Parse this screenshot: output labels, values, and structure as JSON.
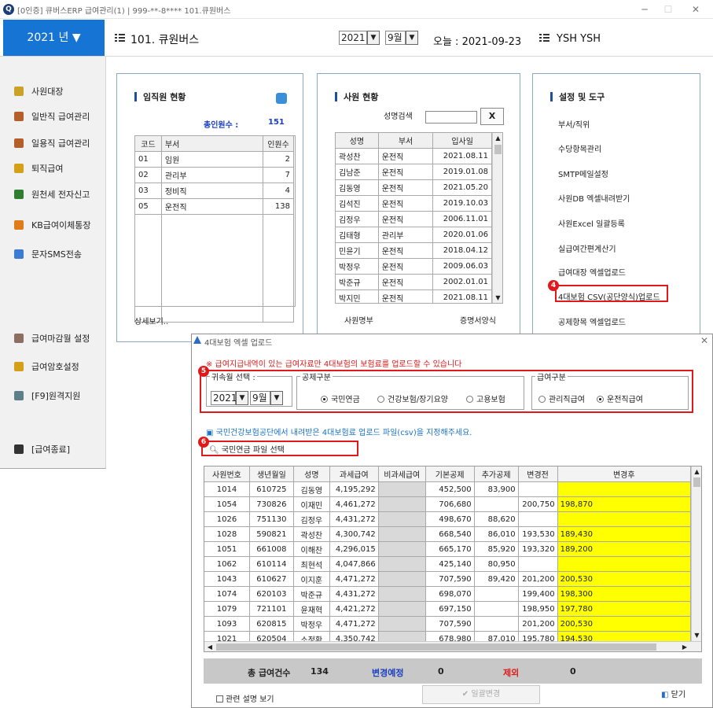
{
  "window": {
    "title": "[0인증] 큐버스ERP 급여관리(1) | 999-**-8**** 101.큐원버스",
    "minimize": "─",
    "maximize": "☐",
    "close": "✕"
  },
  "header": {
    "year_button": "2021 년 ▼",
    "company": "101. 큐원버스",
    "year_select": "2021",
    "month_select": "9월",
    "today": "오늘 : 2021-09-23",
    "user": "YSH YSH"
  },
  "sidebar": {
    "items": [
      {
        "label": "사원대장",
        "icon": "employee-ledger-icon",
        "color": "#c9a227"
      },
      {
        "label": "일반직 급여관리",
        "icon": "payroll-icon",
        "color": "#b45f2a"
      },
      {
        "label": "일용직 급여관리",
        "icon": "daily-payroll-icon",
        "color": "#b45f2a"
      },
      {
        "label": "퇴직급여",
        "icon": "retirement-icon",
        "color": "#d4a017"
      },
      {
        "label": "원천세 전자신고",
        "icon": "tax-report-icon",
        "color": "#2e7d32"
      },
      {
        "label": "KB급여이체통장",
        "icon": "bank-icon",
        "color": "#e07b1a"
      },
      {
        "label": "문자SMS전송",
        "icon": "sms-icon",
        "color": "#3a7bd5"
      },
      {
        "label": "급여마감월 설정",
        "icon": "calendar-icon",
        "color": "#8d6e63"
      },
      {
        "label": "급여암호설정",
        "icon": "lock-icon",
        "color": "#d4a017"
      },
      {
        "label": "[F9]원격지원",
        "icon": "remote-icon",
        "color": "#607d8b"
      },
      {
        "label": "[급여종료]",
        "icon": "exit-icon",
        "color": "#333333"
      }
    ]
  },
  "staff_panel": {
    "title": "임직원 현황",
    "total_label": "총인원수 :",
    "total_value": "151",
    "columns": [
      "코드",
      "부서",
      "인원수"
    ],
    "rows": [
      [
        "01",
        "임원",
        "2"
      ],
      [
        "02",
        "관리부",
        "7"
      ],
      [
        "03",
        "정비직",
        "4"
      ],
      [
        "05",
        "운전직",
        "138"
      ]
    ],
    "detail_link": "상세보기.."
  },
  "employee_panel": {
    "title": "사원 현황",
    "search_label": "성명검색",
    "search_value": "",
    "clear_button": "X",
    "columns": [
      "성명",
      "부서",
      "입사일"
    ],
    "rows": [
      [
        "곽성찬",
        "운전직",
        "2021.08.11"
      ],
      [
        "김남준",
        "운전직",
        "2019.01.08"
      ],
      [
        "김동영",
        "운전직",
        "2021.05.20"
      ],
      [
        "김석진",
        "운전직",
        "2019.10.03"
      ],
      [
        "김정우",
        "운전직",
        "2006.11.01"
      ],
      [
        "김태형",
        "관리부",
        "2020.01.06"
      ],
      [
        "민윤기",
        "운전직",
        "2018.04.12"
      ],
      [
        "박정우",
        "운전직",
        "2009.06.03"
      ],
      [
        "박준규",
        "운전직",
        "2002.01.01"
      ],
      [
        "박지민",
        "운전직",
        "2021.08.11"
      ]
    ],
    "footer_left": "사원명부",
    "footer_right": "증명서양식"
  },
  "tools_panel": {
    "title": "설정 및 도구",
    "items": [
      "부서/직위",
      "수당항목관리",
      "SMTP메일설정",
      "사원DB 엑셀내려받기",
      "사원Excel 일괄등록",
      "실급여간편계산기",
      "급여대장 엑셀업로드",
      "4대보험 CSV(공단양식)업로드",
      "공제항목 엑셀업로드"
    ],
    "badge": "4"
  },
  "popup": {
    "title": "4대보험 엑셀 업로드",
    "close": "✕",
    "notice": "※ 급여지급내역이 있는 급여자료만 4대보험의 보험료를 업로드할 수 있습니다",
    "badge5": "5",
    "badge6": "6",
    "period_legend": "귀속월 선택 :",
    "period_year": "2021",
    "period_month": "9월",
    "deduction_legend": "공제구분",
    "deduction_options": [
      "국민연금",
      "건강보험/장기요양",
      "고용보험"
    ],
    "deduction_selected": 0,
    "pay_legend": "급여구분",
    "pay_options": [
      "관리직급여",
      "운전직급여"
    ],
    "pay_selected": 1,
    "hint": "▣ 국민건강보험공단에서 내려받은 4대보험료 업로드 파일(csv)을 지정해주세요.",
    "file_button": "국민연금 파일 선택",
    "columns": [
      "사원번호",
      "생년월일",
      "성명",
      "과세급여",
      "비과세급여",
      "기본공제",
      "추가공제",
      "변경전",
      "변경후"
    ],
    "rows": [
      [
        "1014",
        "610725",
        "김동영",
        "4,195,292",
        "",
        "452,500",
        "83,900",
        "",
        ""
      ],
      [
        "1054",
        "730826",
        "이재민",
        "4,461,272",
        "",
        "706,680",
        "",
        "200,750",
        "198,870"
      ],
      [
        "1026",
        "751130",
        "김정우",
        "4,431,272",
        "",
        "498,670",
        "88,620",
        "",
        ""
      ],
      [
        "1028",
        "590821",
        "곽성찬",
        "4,300,742",
        "",
        "668,540",
        "86,010",
        "193,530",
        "189,430"
      ],
      [
        "1051",
        "661008",
        "이해찬",
        "4,296,015",
        "",
        "665,170",
        "85,920",
        "193,320",
        "189,200"
      ],
      [
        "1062",
        "610114",
        "최현석",
        "4,047,866",
        "",
        "425,140",
        "80,950",
        "",
        ""
      ],
      [
        "1043",
        "610627",
        "이지훈",
        "4,471,272",
        "",
        "707,590",
        "89,420",
        "201,200",
        "200,530"
      ],
      [
        "1074",
        "620103",
        "박준규",
        "4,431,272",
        "",
        "698,070",
        "",
        "199,400",
        "198,300"
      ],
      [
        "1079",
        "721101",
        "윤재혁",
        "4,421,272",
        "",
        "697,150",
        "",
        "198,950",
        "197,780"
      ],
      [
        "1093",
        "620815",
        "박정우",
        "4,471,272",
        "",
        "707,590",
        "",
        "201,200",
        "200,530"
      ],
      [
        "1021",
        "620504",
        "소정환",
        "4,350,742",
        "",
        "678,980",
        "87,010",
        "195,780",
        "194,530"
      ]
    ],
    "summary": {
      "total_label": "총 급여건수",
      "total_value": "134",
      "changed_label": "변경예정",
      "changed_value": "0",
      "excluded_label": "제외",
      "excluded_value": "0"
    },
    "help_link": "관련 설명 보기",
    "apply_button": "일괄변경",
    "close_button": "닫기"
  },
  "colors": {
    "accent": "#1574d4",
    "highlight_red": "#e01a1a",
    "changed_cell": "#ffff00",
    "link_blue": "#1a3fbf"
  }
}
